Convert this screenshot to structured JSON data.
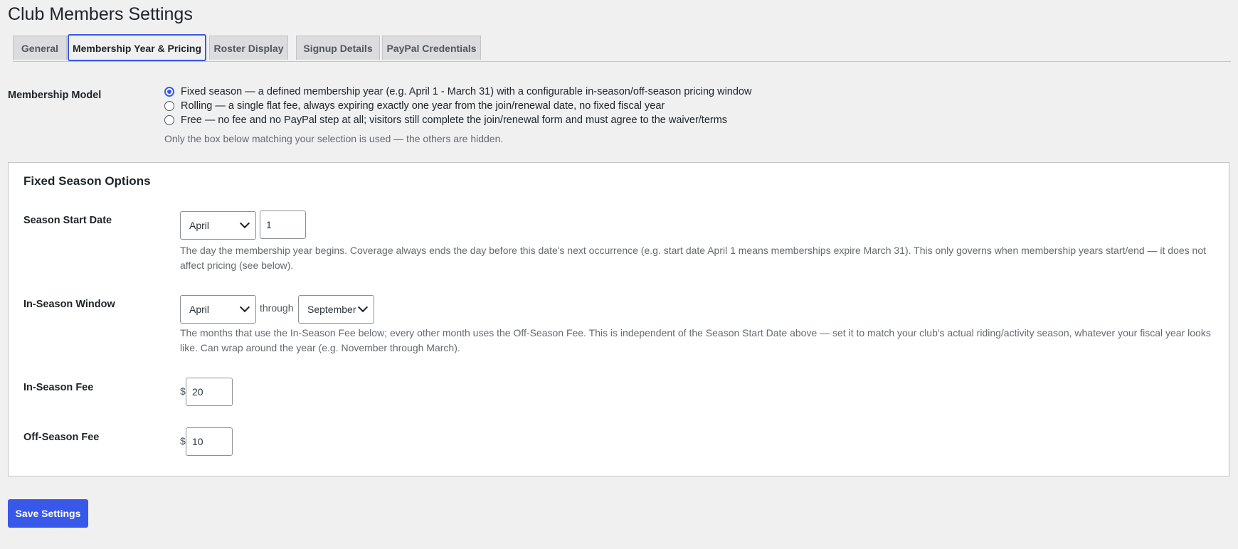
{
  "page": {
    "title": "Club Members Settings"
  },
  "tabs": [
    {
      "label": "General"
    },
    {
      "label": "Membership Year & Pricing"
    },
    {
      "label": "Roster Display"
    },
    {
      "label": "Signup Details"
    },
    {
      "label": "PayPal Credentials"
    }
  ],
  "active_tab": "Membership Year & Pricing",
  "membership_model": {
    "label": "Membership Model",
    "options": [
      {
        "label": "Fixed season — a defined membership year (e.g. April 1 - March 31) with a configurable in-season/off-season pricing window",
        "selected": true
      },
      {
        "label": "Rolling — a single flat fee, always expiring exactly one year from the join/renewal date, no fixed fiscal year",
        "selected": false
      },
      {
        "label": "Free — no fee and no PayPal step at all; visitors still complete the join/renewal form and must agree to the waiver/terms",
        "selected": false
      }
    ],
    "hint": "Only the box below matching your selection is used — the others are hidden."
  },
  "fixed_season": {
    "title": "Fixed Season Options",
    "start_date": {
      "label": "Season Start Date",
      "month": "April",
      "day": "1",
      "description": "The day the membership year begins. Coverage always ends the day before this date's next occurrence (e.g. start date April 1 means memberships expire March 31). This only governs when membership years start/end — it does not affect pricing (see below)."
    },
    "window": {
      "label": "In-Season Window",
      "from": "April",
      "through_label": "through",
      "to": "September",
      "description": "The months that use the In-Season Fee below; every other month uses the Off-Season Fee. This is independent of the Season Start Date above — set it to match your club's actual riding/activity season, whatever your fiscal year looks like. Can wrap around the year (e.g. November through March)."
    },
    "in_season_fee": {
      "label": "In-Season Fee",
      "currency": "$",
      "value": "20"
    },
    "off_season_fee": {
      "label": "Off-Season Fee",
      "currency": "$",
      "value": "10"
    }
  },
  "save_button": {
    "label": "Save Settings"
  },
  "colors": {
    "accent": "#3858e9",
    "background": "#f0f0f1",
    "panel": "#ffffff"
  }
}
